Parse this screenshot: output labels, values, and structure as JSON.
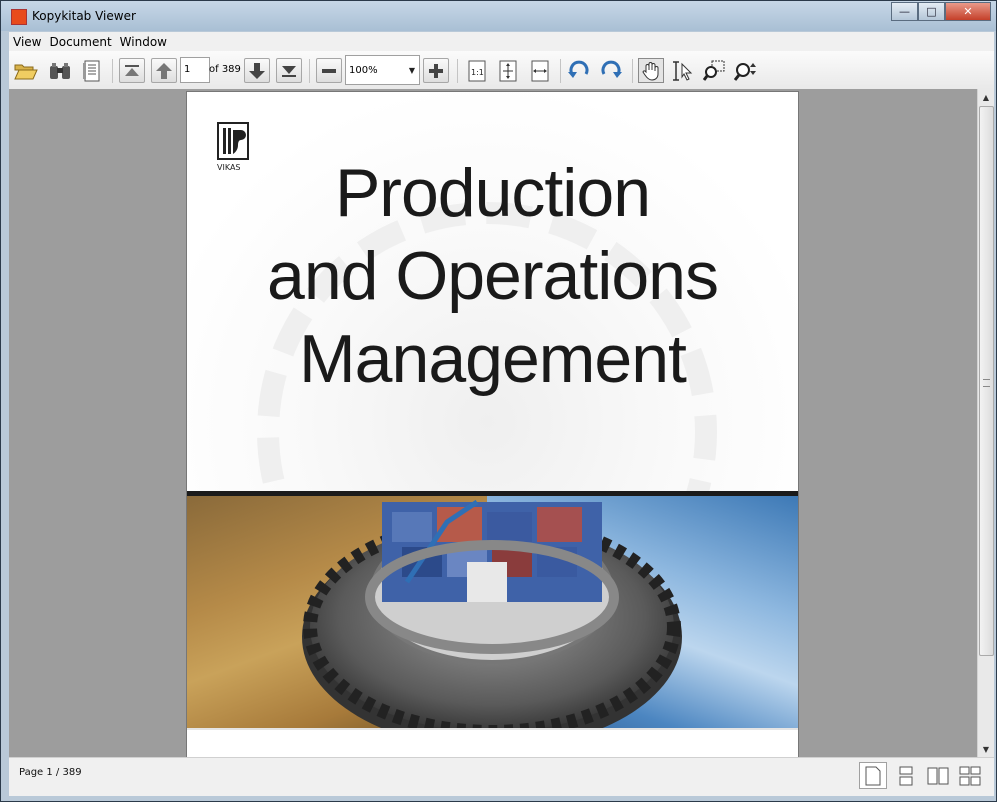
{
  "window": {
    "title": "Kopykitab Viewer"
  },
  "menu": {
    "items": [
      "View",
      "Document",
      "Window"
    ]
  },
  "toolbar": {
    "page_input": "1",
    "page_of": "of 389",
    "zoom_value": "100%"
  },
  "document": {
    "title_lines": [
      "Production",
      "and Operations",
      "Management"
    ],
    "publisher": "VIKAS"
  },
  "status": {
    "page_text": "Page 1 / 389"
  },
  "colors": {
    "accent_red": "#e84b1c",
    "viewport_bg": "#9d9d9d",
    "toolbar_blue": "#2f6fb5"
  },
  "icons": {
    "toolbar": [
      "open-folder-icon",
      "find-binoculars-icon",
      "page-panel-icon",
      "first-page-icon",
      "previous-page-icon",
      "next-page-icon",
      "last-page-icon",
      "zoom-out-icon",
      "zoom-in-icon",
      "actual-size-icon",
      "fit-page-icon",
      "fit-width-icon",
      "rotate-counterclockwise-icon",
      "rotate-clockwise-icon",
      "hand-tool-icon",
      "text-select-icon",
      "marquee-zoom-icon",
      "dynamic-zoom-icon"
    ],
    "status": [
      "single-page-icon",
      "continuous-icon",
      "two-page-icon",
      "two-page-continuous-icon"
    ]
  }
}
